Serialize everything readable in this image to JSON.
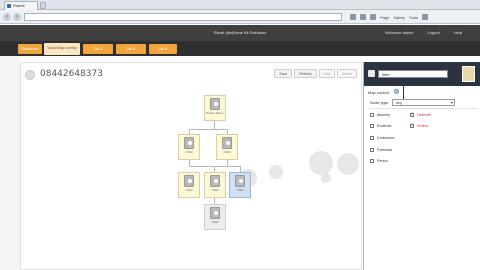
{
  "browser": {
    "tab_title": "Rabbit",
    "address": "",
    "tools": [
      "Page",
      "Safety",
      "Tools"
    ]
  },
  "header": {
    "title": "Elsnik (dis)Hone Kit Solutions",
    "links": [
      "Welcome admin",
      "Logout",
      "Help"
    ]
  },
  "tabs": [
    "Dashboard",
    "Visual Map overlay",
    "Tab 3",
    "Tab 4",
    "Tab 5"
  ],
  "case": {
    "id": "08442648373"
  },
  "toolbar": {
    "buttons": [
      "Save",
      "Refresh",
      "Add",
      "Delete"
    ]
  },
  "tree": {
    "nodes": [
      {
        "label": "Parent Name"
      },
      {
        "label": "Child"
      },
      {
        "label": "Child"
      },
      {
        "label": "Child"
      },
      {
        "label": "Child"
      },
      {
        "label": "Child"
      },
      {
        "label": "Child"
      }
    ]
  },
  "side": {
    "search_value": "filter",
    "map_control_label": "Map control",
    "nodes_type_label": "Node type",
    "select_value": "Any",
    "checkboxes": [
      {
        "label": "Attorney",
        "checked": false
      },
      {
        "label": "Defender",
        "checked": true
      },
      {
        "label": "Evidence",
        "checked": false
      },
      {
        "label": "Victims",
        "checked": true
      },
      {
        "label": "Confession",
        "checked": false
      },
      {
        "label": "Forensics",
        "checked": false
      },
      {
        "label": "Person",
        "checked": false
      }
    ]
  },
  "colors": {
    "tab_orange": "#f0a63c",
    "header_dark": "#3f3f3f",
    "node_fill": "#fdf8d5",
    "node_selected": "#cfe0f5"
  }
}
